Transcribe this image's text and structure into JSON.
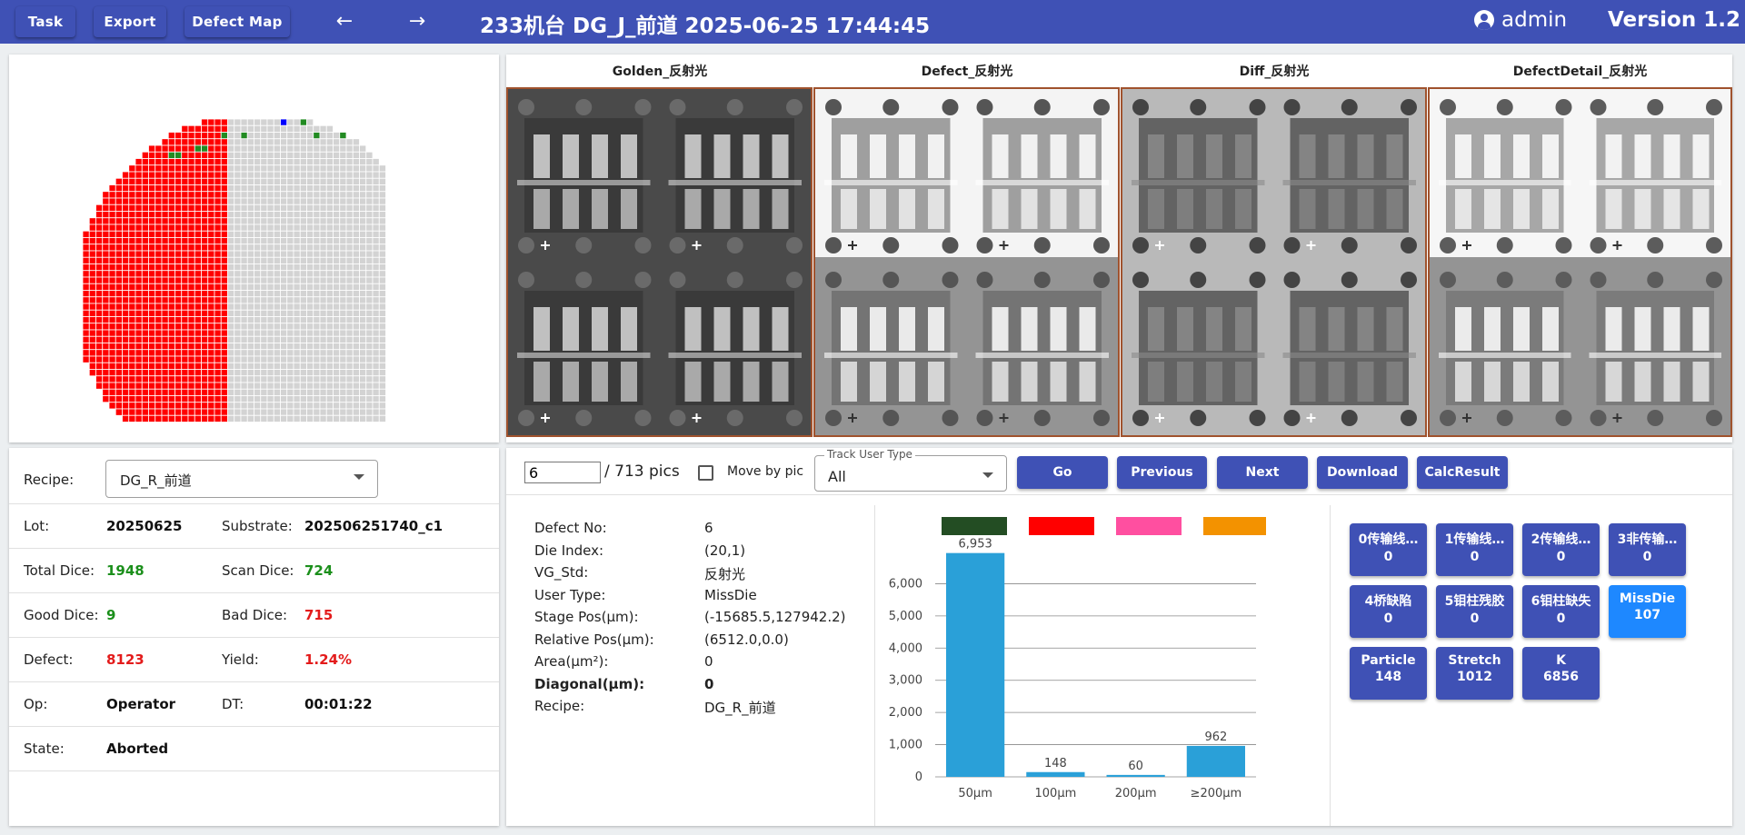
{
  "header": {
    "buttons": [
      {
        "label": "Task"
      },
      {
        "label": "Export"
      },
      {
        "label": "Defect Map"
      }
    ],
    "title": "233机台   DG_J_前道   2025-06-25 17:44:45",
    "user": "admin",
    "version": "Version 1.2"
  },
  "wafer": {
    "colors": {
      "good": "#228b22",
      "bad": "#ff0000",
      "scanned_other": "#0000ff",
      "unscanned": "#d3d3d3",
      "grid": "#ffffff"
    },
    "green_cells": [
      [
        5,
        13
      ],
      [
        5,
        14
      ],
      [
        4,
        17
      ],
      [
        4,
        18
      ],
      [
        2,
        21
      ],
      [
        2,
        24
      ],
      [
        0,
        33
      ],
      [
        2,
        35
      ],
      [
        2,
        39
      ],
      [
        2,
        40
      ]
    ],
    "blue_cells": [
      [
        0,
        30
      ]
    ]
  },
  "images": [
    {
      "label": "Golden_反射光"
    },
    {
      "label": "Defect_反射光"
    },
    {
      "label": "Diff_反射光"
    },
    {
      "label": "DefectDetail_反射光"
    }
  ],
  "info": {
    "recipe_label": "Recipe:",
    "recipe_value": "DG_R_前道",
    "rows": [
      {
        "l1": "Lot:",
        "v1": "20250625",
        "l2": "Substrate:",
        "v2": "202506251740_c1"
      },
      {
        "l1": "Total Dice:",
        "v1": "1948",
        "l2": "Scan Dice:",
        "v2": "724"
      },
      {
        "l1": "Good Dice:",
        "v1": "9",
        "l2": "Bad Dice:",
        "v2": "715"
      },
      {
        "l1": "Defect:",
        "v1": "8123",
        "l2": "Yield:",
        "v2": "1.24%"
      },
      {
        "l1": "Op:",
        "v1": "Operator",
        "l2": "DT:",
        "v2": "00:01:22"
      },
      {
        "l1": "State:",
        "v1": "Aborted",
        "l2": "",
        "v2": ""
      }
    ]
  },
  "controls": {
    "page_value": "6",
    "pics_text": "/ 713 pics",
    "move_by_pic": "Move by pic",
    "track_legend": "Track User Type",
    "track_value": "All",
    "buttons": [
      {
        "label": "Go"
      },
      {
        "label": "Previous"
      },
      {
        "label": "Next"
      },
      {
        "label": "Download"
      },
      {
        "label": "CalcResult"
      }
    ]
  },
  "defect": [
    {
      "label": "Defect No:",
      "value": "6"
    },
    {
      "label": "Die Index:",
      "value": "(20,1)"
    },
    {
      "label": "VG_Std:",
      "value": "反射光"
    },
    {
      "label": "User Type:",
      "value": "MissDie"
    },
    {
      "label": "Stage Pos(μm):",
      "value": "(-15685.5,127942.2)"
    },
    {
      "label": "Relative Pos(μm):",
      "value": "(6512.0,0.0)"
    },
    {
      "label": "Area(μm²):",
      "value": "0"
    },
    {
      "label": "Diagonal(μm):",
      "value": "0"
    },
    {
      "label": "Recipe:",
      "value": "DG_R_前道"
    }
  ],
  "chart_data": {
    "type": "bar",
    "categories": [
      "50μm",
      "100μm",
      "200μm",
      "≥200μm"
    ],
    "values": [
      6953,
      148,
      60,
      962
    ],
    "value_labels": [
      "6,953",
      "148",
      "60",
      "962"
    ],
    "ytick_labels": [
      "0",
      "1,000",
      "2,000",
      "3,000",
      "4,000",
      "5,000",
      "6,000"
    ],
    "ylim": [
      0,
      7000
    ],
    "bar_color": "#2aa0d8",
    "legend_colors": [
      "#234d23",
      "#ff0000",
      "#ff4fa0",
      "#f39200"
    ],
    "grid": true
  },
  "categories": [
    {
      "name": "0传输线…",
      "count": "0",
      "active": false
    },
    {
      "name": "1传输线…",
      "count": "0",
      "active": false
    },
    {
      "name": "2传输线…",
      "count": "0",
      "active": false
    },
    {
      "name": "3非传输…",
      "count": "0",
      "active": false
    },
    {
      "name": "4桥缺陷",
      "count": "0",
      "active": false
    },
    {
      "name": "5钼柱残胶",
      "count": "0",
      "active": false
    },
    {
      "name": "6钼柱缺失",
      "count": "0",
      "active": false
    },
    {
      "name": "MissDie",
      "count": "107",
      "active": true
    },
    {
      "name": "Particle",
      "count": "148",
      "active": false
    },
    {
      "name": "Stretch",
      "count": "1012",
      "active": false
    },
    {
      "name": "K",
      "count": "6856",
      "active": false
    }
  ]
}
